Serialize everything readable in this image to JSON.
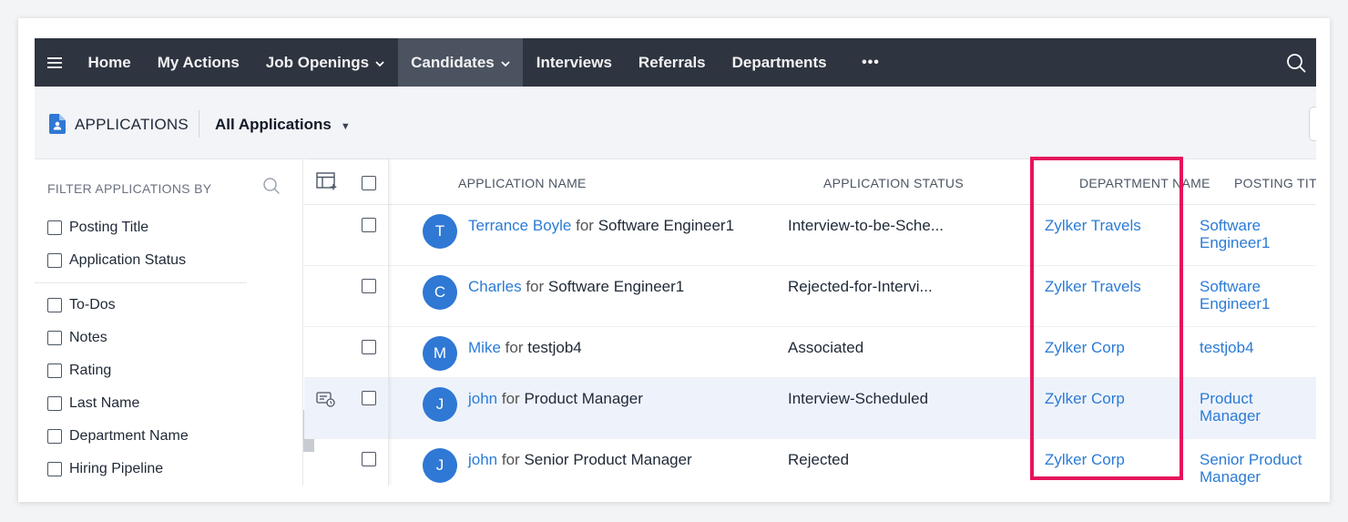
{
  "nav": {
    "items": [
      {
        "label": "Home",
        "dropdown": false,
        "active": false
      },
      {
        "label": "My Actions",
        "dropdown": false,
        "active": false
      },
      {
        "label": "Job Openings",
        "dropdown": true,
        "active": false
      },
      {
        "label": "Candidates",
        "dropdown": true,
        "active": true
      },
      {
        "label": "Interviews",
        "dropdown": false,
        "active": false
      },
      {
        "label": "Referrals",
        "dropdown": false,
        "active": false
      },
      {
        "label": "Departments",
        "dropdown": false,
        "active": false
      }
    ],
    "more_label": "•••",
    "chevron": "⌄"
  },
  "subheader": {
    "module_title": "APPLICATIONS",
    "view_name": "All Applications",
    "view_caret": "▼"
  },
  "filter": {
    "title": "FILTER APPLICATIONS BY",
    "group1": [
      "Posting Title",
      "Application Status"
    ],
    "group2": [
      "To-Dos",
      "Notes",
      "Rating",
      "Last Name",
      "Department Name",
      "Hiring Pipeline"
    ],
    "collapse_glyph": "‹"
  },
  "table": {
    "columns": {
      "application_name": "APPLICATION NAME",
      "application_status": "APPLICATION STATUS",
      "department_name": "DEPARTMENT NAME",
      "posting_title": "POSTING TITLE"
    },
    "rows": [
      {
        "initial": "T",
        "candidate": "Terrance Boyle",
        "for": "for",
        "job": "Software Engineer1",
        "status": "Interview-to-be-Sche...",
        "department": "Zylker Travels",
        "posting": "Software Engineer1",
        "highlight": false,
        "has_action_icon": false
      },
      {
        "initial": "C",
        "candidate": "Charles",
        "for": "for",
        "job": "Software Engineer1",
        "status": "Rejected-for-Intervi...",
        "department": "Zylker Travels",
        "posting": "Software Engineer1",
        "highlight": false,
        "has_action_icon": false
      },
      {
        "initial": "M",
        "candidate": "Mike",
        "for": "for",
        "job": "testjob4",
        "status": "Associated",
        "department": "Zylker Corp",
        "posting": "testjob4",
        "highlight": false,
        "has_action_icon": false
      },
      {
        "initial": "J",
        "candidate": "john",
        "for": "for",
        "job": "Product Manager",
        "status": "Interview-Scheduled",
        "department": "Zylker Corp",
        "posting": "Product Manager",
        "highlight": true,
        "has_action_icon": true
      },
      {
        "initial": "J",
        "candidate": "john",
        "for": "for",
        "job": "Senior Product Manager",
        "status": "Rejected",
        "department": "Zylker Corp",
        "posting": "Senior Product Manager",
        "highlight": false,
        "has_action_icon": false
      }
    ]
  },
  "colors": {
    "nav_bg": "#2e3440",
    "nav_active": "#4b5361",
    "link": "#2b7bd5",
    "avatar": "#2f78d4",
    "highlight_border": "#e6145c",
    "row_highlight": "#eef3fb"
  },
  "icons": {
    "menu": "hamburger-icon",
    "search": "search-icon",
    "module": "document-user-icon",
    "column_chooser": "column-add-icon",
    "row_action": "schedule-chat-icon"
  }
}
